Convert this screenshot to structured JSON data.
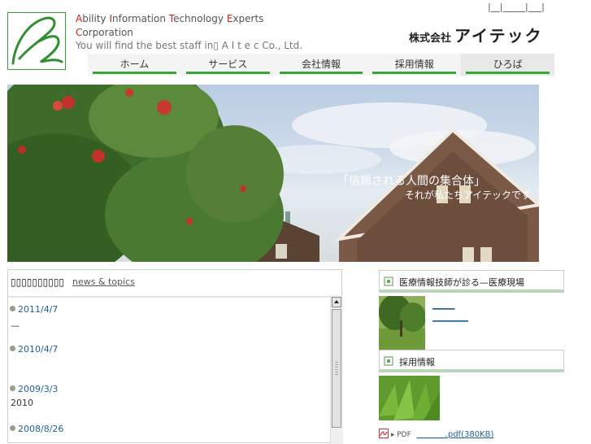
{
  "header": {
    "tagline": {
      "line1": [
        [
          "A",
          "bility "
        ],
        [
          "I",
          "nformation "
        ],
        [
          "T",
          "echnology "
        ],
        [
          "E",
          "xperts"
        ]
      ],
      "line2": [
        [
          "C",
          "orporation"
        ]
      ],
      "line3": "You will find the best staff in▯ A I t e c Co., Ltd."
    },
    "toplinks": [
      "|",
      "__",
      "|",
      "_____",
      "|",
      "___",
      "|"
    ],
    "company": {
      "prefix": "株式会社",
      "name": "アイテック"
    }
  },
  "nav": [
    {
      "label": "ホーム"
    },
    {
      "label": "サービス"
    },
    {
      "label": "会社情報"
    },
    {
      "label": "採用情報"
    },
    {
      "label": "ひろば"
    }
  ],
  "hero": {
    "caption_main": "「信頼される人間の集合体」",
    "caption_sub": "それが私たちアイテックです"
  },
  "news": {
    "heading_tofu": "▯▯▯▯▯▯▯▯▯▯",
    "heading_link": "news & topics",
    "items": [
      {
        "date": "2011/4/7",
        "text": "—"
      },
      {
        "date": "2010/4/7",
        "text": ""
      },
      {
        "date": "2009/3/3",
        "text": "2010"
      },
      {
        "date": "2008/8/26",
        "text": ""
      }
    ]
  },
  "side": {
    "section1": {
      "title": "医療情報技師が診る—医療現場",
      "link1": "_____",
      "link2": "________"
    },
    "section2": {
      "title": "採用情報"
    },
    "pdf": {
      "badge": "▸ PDF",
      "link": "_______.pdf(380KB)"
    }
  },
  "colors": {
    "accent_green": "#3aa63a",
    "link_blue": "#1f5f9a",
    "cap_red": "#cc2020"
  }
}
